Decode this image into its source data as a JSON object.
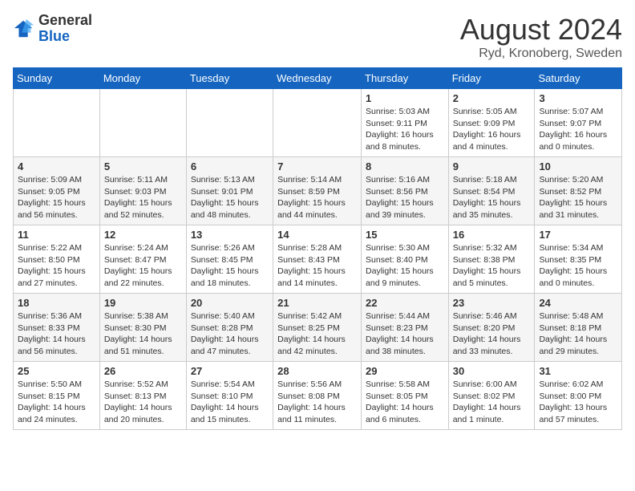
{
  "header": {
    "logo_general": "General",
    "logo_blue": "Blue",
    "month_title": "August 2024",
    "location": "Ryd, Kronoberg, Sweden"
  },
  "days_of_week": [
    "Sunday",
    "Monday",
    "Tuesday",
    "Wednesday",
    "Thursday",
    "Friday",
    "Saturday"
  ],
  "weeks": [
    [
      {
        "day": "",
        "info": ""
      },
      {
        "day": "",
        "info": ""
      },
      {
        "day": "",
        "info": ""
      },
      {
        "day": "",
        "info": ""
      },
      {
        "day": "1",
        "info": "Sunrise: 5:03 AM\nSunset: 9:11 PM\nDaylight: 16 hours\nand 8 minutes."
      },
      {
        "day": "2",
        "info": "Sunrise: 5:05 AM\nSunset: 9:09 PM\nDaylight: 16 hours\nand 4 minutes."
      },
      {
        "day": "3",
        "info": "Sunrise: 5:07 AM\nSunset: 9:07 PM\nDaylight: 16 hours\nand 0 minutes."
      }
    ],
    [
      {
        "day": "4",
        "info": "Sunrise: 5:09 AM\nSunset: 9:05 PM\nDaylight: 15 hours\nand 56 minutes."
      },
      {
        "day": "5",
        "info": "Sunrise: 5:11 AM\nSunset: 9:03 PM\nDaylight: 15 hours\nand 52 minutes."
      },
      {
        "day": "6",
        "info": "Sunrise: 5:13 AM\nSunset: 9:01 PM\nDaylight: 15 hours\nand 48 minutes."
      },
      {
        "day": "7",
        "info": "Sunrise: 5:14 AM\nSunset: 8:59 PM\nDaylight: 15 hours\nand 44 minutes."
      },
      {
        "day": "8",
        "info": "Sunrise: 5:16 AM\nSunset: 8:56 PM\nDaylight: 15 hours\nand 39 minutes."
      },
      {
        "day": "9",
        "info": "Sunrise: 5:18 AM\nSunset: 8:54 PM\nDaylight: 15 hours\nand 35 minutes."
      },
      {
        "day": "10",
        "info": "Sunrise: 5:20 AM\nSunset: 8:52 PM\nDaylight: 15 hours\nand 31 minutes."
      }
    ],
    [
      {
        "day": "11",
        "info": "Sunrise: 5:22 AM\nSunset: 8:50 PM\nDaylight: 15 hours\nand 27 minutes."
      },
      {
        "day": "12",
        "info": "Sunrise: 5:24 AM\nSunset: 8:47 PM\nDaylight: 15 hours\nand 22 minutes."
      },
      {
        "day": "13",
        "info": "Sunrise: 5:26 AM\nSunset: 8:45 PM\nDaylight: 15 hours\nand 18 minutes."
      },
      {
        "day": "14",
        "info": "Sunrise: 5:28 AM\nSunset: 8:43 PM\nDaylight: 15 hours\nand 14 minutes."
      },
      {
        "day": "15",
        "info": "Sunrise: 5:30 AM\nSunset: 8:40 PM\nDaylight: 15 hours\nand 9 minutes."
      },
      {
        "day": "16",
        "info": "Sunrise: 5:32 AM\nSunset: 8:38 PM\nDaylight: 15 hours\nand 5 minutes."
      },
      {
        "day": "17",
        "info": "Sunrise: 5:34 AM\nSunset: 8:35 PM\nDaylight: 15 hours\nand 0 minutes."
      }
    ],
    [
      {
        "day": "18",
        "info": "Sunrise: 5:36 AM\nSunset: 8:33 PM\nDaylight: 14 hours\nand 56 minutes."
      },
      {
        "day": "19",
        "info": "Sunrise: 5:38 AM\nSunset: 8:30 PM\nDaylight: 14 hours\nand 51 minutes."
      },
      {
        "day": "20",
        "info": "Sunrise: 5:40 AM\nSunset: 8:28 PM\nDaylight: 14 hours\nand 47 minutes."
      },
      {
        "day": "21",
        "info": "Sunrise: 5:42 AM\nSunset: 8:25 PM\nDaylight: 14 hours\nand 42 minutes."
      },
      {
        "day": "22",
        "info": "Sunrise: 5:44 AM\nSunset: 8:23 PM\nDaylight: 14 hours\nand 38 minutes."
      },
      {
        "day": "23",
        "info": "Sunrise: 5:46 AM\nSunset: 8:20 PM\nDaylight: 14 hours\nand 33 minutes."
      },
      {
        "day": "24",
        "info": "Sunrise: 5:48 AM\nSunset: 8:18 PM\nDaylight: 14 hours\nand 29 minutes."
      }
    ],
    [
      {
        "day": "25",
        "info": "Sunrise: 5:50 AM\nSunset: 8:15 PM\nDaylight: 14 hours\nand 24 minutes."
      },
      {
        "day": "26",
        "info": "Sunrise: 5:52 AM\nSunset: 8:13 PM\nDaylight: 14 hours\nand 20 minutes."
      },
      {
        "day": "27",
        "info": "Sunrise: 5:54 AM\nSunset: 8:10 PM\nDaylight: 14 hours\nand 15 minutes."
      },
      {
        "day": "28",
        "info": "Sunrise: 5:56 AM\nSunset: 8:08 PM\nDaylight: 14 hours\nand 11 minutes."
      },
      {
        "day": "29",
        "info": "Sunrise: 5:58 AM\nSunset: 8:05 PM\nDaylight: 14 hours\nand 6 minutes."
      },
      {
        "day": "30",
        "info": "Sunrise: 6:00 AM\nSunset: 8:02 PM\nDaylight: 14 hours\nand 1 minute."
      },
      {
        "day": "31",
        "info": "Sunrise: 6:02 AM\nSunset: 8:00 PM\nDaylight: 13 hours\nand 57 minutes."
      }
    ]
  ]
}
